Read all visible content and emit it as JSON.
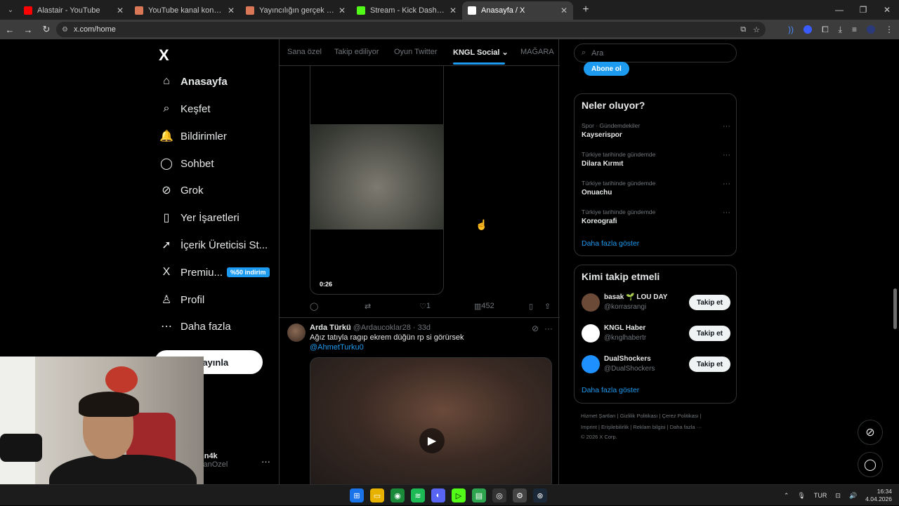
{
  "browser": {
    "tabs": [
      {
        "title": "Alastair - YouTube",
        "favicon_color": "#ff0000",
        "active": false
      },
      {
        "title": "YouTube kanal konumlandırma",
        "favicon_color": "#d97757",
        "active": false
      },
      {
        "title": "Yayıncılığın gerçek hazırlığı - Cl",
        "favicon_color": "#d97757",
        "active": false
      },
      {
        "title": "Stream - Kick Dashboard",
        "favicon_color": "#53fc18",
        "active": false
      },
      {
        "title": "Anasayfa / X",
        "favicon_color": "#ffffff",
        "active": true
      }
    ],
    "url": "x.com/home"
  },
  "leftnav": {
    "logo": "X",
    "items": [
      {
        "label": "Anasayfa",
        "icon": "home-icon",
        "glyph": "⌂"
      },
      {
        "label": "Keşfet",
        "icon": "search-icon",
        "glyph": "⌕"
      },
      {
        "label": "Bildirimler",
        "icon": "bell-icon",
        "glyph": "🔔"
      },
      {
        "label": "Sohbet",
        "icon": "chat-icon",
        "glyph": "◯"
      },
      {
        "label": "Grok",
        "icon": "grok-icon",
        "glyph": "⊘"
      },
      {
        "label": "Yer İşaretleri",
        "icon": "bookmark-icon",
        "glyph": "▯"
      },
      {
        "label": "İçerik Üreticisi St...",
        "icon": "rocket-icon",
        "glyph": "➚"
      },
      {
        "label": "Premiu...",
        "icon": "x-premium-icon",
        "glyph": "X",
        "badge": "%50 indirim"
      },
      {
        "label": "Profil",
        "icon": "profile-icon",
        "glyph": "♙"
      },
      {
        "label": "Daha fazla",
        "icon": "more-circle-icon",
        "glyph": "⋯"
      }
    ],
    "post_button": "ri yayınla",
    "account": {
      "name": "nn4k",
      "handle": "canOzel"
    }
  },
  "timeline": {
    "tabs": [
      "Sana özel",
      "Takip ediliyor",
      "Oyun Twitter",
      "KNGL Social",
      "MAĞARA"
    ],
    "active_tab": "KNGL Social",
    "tweet1": {
      "video_duration": "0:26",
      "likes": "1",
      "views": "452"
    },
    "tweet2": {
      "name": "Arda Türkü",
      "handle_time": "@Ardaucoklar28 · 33d",
      "text": "Ağız tatıyla ragıp ekrem düğün rp si görürsek",
      "mention": "@AhmetTurku0"
    }
  },
  "sidebar": {
    "search_placeholder": "Ara",
    "subscribe_button": "Abone ol",
    "trends_title": "Neler oluyor?",
    "trends": [
      {
        "category": "Spor · Gündemdekiler",
        "name": "Kayserispor"
      },
      {
        "category": "Türkiye tarihinde gündemde",
        "name": "Dilara Kırmıt"
      },
      {
        "category": "Türkiye tarihinde gündemde",
        "name": "Onuachu"
      },
      {
        "category": "Türkiye tarihinde gündemde",
        "name": "Koreografi"
      }
    ],
    "show_more": "Daha fazla göster",
    "who_title": "Kimi takip etmeli",
    "who": [
      {
        "name": "basak 🌱 LOU DAY",
        "handle": "@korrasrangi",
        "avatar_color": "#6b4a38"
      },
      {
        "name": "KNGL Haber",
        "handle": "@knglhabertr",
        "avatar_color": "#ffffff"
      },
      {
        "name": "DualShockers",
        "handle": "@DualShockers",
        "avatar_color": "#1e90ff"
      }
    ],
    "follow_label": "Takip et",
    "footer_line1": "Hizmet Şartları  |  Gizlilik Politikası  |  Çerez Politikası  |",
    "footer_line2": "Imprint  |  Erişilebilirlik  |  Reklam bilgisi  |  Daha fazla ···",
    "footer_line3": "© 2026 X Corp."
  },
  "taskbar": {
    "language": "TUR",
    "time": "16:34",
    "date": "4.04.2026"
  }
}
